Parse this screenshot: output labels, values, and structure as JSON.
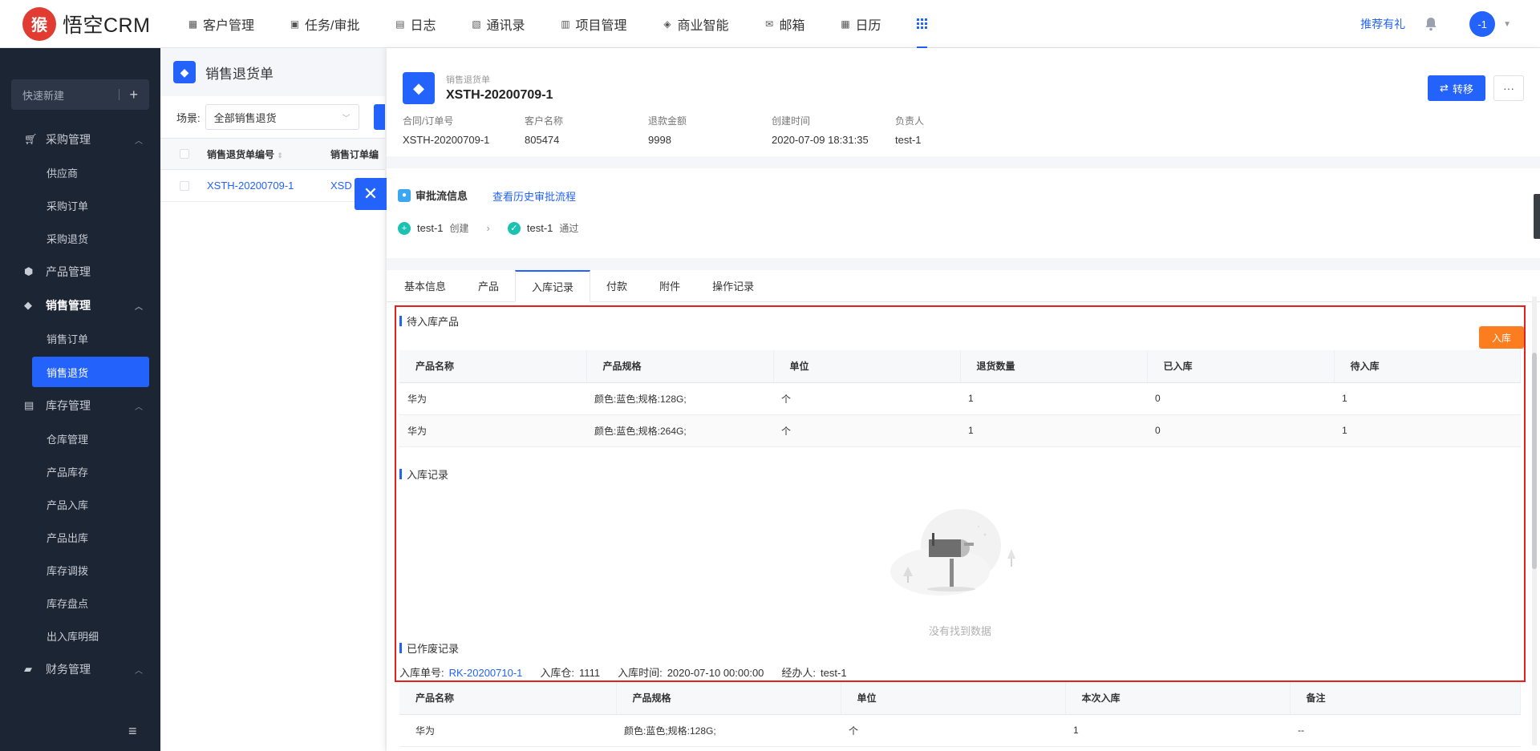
{
  "brand": {
    "name": "悟空CRM",
    "logo_glyph": "猴"
  },
  "nav": {
    "items": [
      {
        "label": "客户管理",
        "icon": "building-icon"
      },
      {
        "label": "任务/审批",
        "icon": "briefcase-icon"
      },
      {
        "label": "日志",
        "icon": "log-icon"
      },
      {
        "label": "通讯录",
        "icon": "contacts-icon"
      },
      {
        "label": "项目管理",
        "icon": "project-icon"
      },
      {
        "label": "商业智能",
        "icon": "bi-icon"
      },
      {
        "label": "邮箱",
        "icon": "mail-icon"
      },
      {
        "label": "日历",
        "icon": "calendar-icon"
      }
    ],
    "recommend": "推荐有礼",
    "avatar": "-1"
  },
  "sidebar": {
    "quick_new": "快速新建",
    "groups": [
      {
        "label": "采购管理",
        "items": [
          "供应商",
          "采购订单",
          "采购退货"
        ]
      },
      {
        "label": "产品管理",
        "items": []
      },
      {
        "label": "销售管理",
        "items": [
          "销售订单",
          "销售退货"
        ]
      },
      {
        "label": "库存管理",
        "items": [
          "仓库管理",
          "产品库存",
          "产品入库",
          "产品出库",
          "库存调拨",
          "库存盘点",
          "出入库明细"
        ]
      },
      {
        "label": "财务管理",
        "items": []
      }
    ],
    "active_item": "销售退货"
  },
  "list": {
    "title": "销售退货单",
    "scene_label": "场景:",
    "scene_value": "全部销售退货",
    "columns": [
      "销售退货单编号",
      "销售订单编"
    ],
    "rows": [
      {
        "no": "XSTH-20200709-1",
        "order": "XSD"
      }
    ]
  },
  "detail": {
    "type_label": "销售退货单",
    "number": "XSTH-20200709-1",
    "transfer_label": "转移",
    "more_label": "···",
    "fields": [
      {
        "key": "合同/订单号",
        "value": "XSTH-20200709-1"
      },
      {
        "key": "客户名称",
        "value": "805474"
      },
      {
        "key": "退款金额",
        "value": "9998"
      },
      {
        "key": "创建时间",
        "value": "2020-07-09 18:31:35"
      },
      {
        "key": "负责人",
        "value": "test-1"
      }
    ],
    "approval": {
      "title": "审批流信息",
      "history_link": "查看历史审批流程",
      "steps": [
        {
          "user": "test-1",
          "action": "创建",
          "color": "#1bc2b2"
        },
        {
          "user": "test-1",
          "action": "通过",
          "color": "#1bc2b2"
        }
      ]
    },
    "tabs": [
      "基本信息",
      "产品",
      "入库记录",
      "付款",
      "附件",
      "操作记录"
    ],
    "active_tab": "入库记录",
    "pending": {
      "title": "待入库产品",
      "button": "入库",
      "columns": [
        "产品名称",
        "产品规格",
        "单位",
        "退货数量",
        "已入库",
        "待入库"
      ],
      "rows": [
        [
          "华为",
          "颜色:蓝色;规格:128G;",
          "个",
          "1",
          "0",
          "1"
        ],
        [
          "华为",
          "颜色:蓝色;规格:264G;",
          "个",
          "1",
          "0",
          "1"
        ]
      ]
    },
    "records": {
      "title": "入库记录",
      "empty_text": "没有找到数据"
    },
    "voided": {
      "title": "已作废记录",
      "order_no_label": "入库单号:",
      "order_no": "RK-20200710-1",
      "warehouse_label": "入库仓:",
      "warehouse": "1111",
      "time_label": "入库时间:",
      "time": "2020-07-10 00:00:00",
      "handler_label": "经办人:",
      "handler": "test-1",
      "columns": [
        "产品名称",
        "产品规格",
        "单位",
        "本次入库",
        "备注"
      ],
      "rows": [
        [
          "华为",
          "颜色:蓝色;规格:128G;",
          "个",
          "1",
          "--"
        ]
      ]
    }
  },
  "colors": {
    "primary": "#2362fb",
    "orange": "#fb7d1f",
    "highlight": "#e3201b",
    "sidebar": "#1c2533"
  }
}
